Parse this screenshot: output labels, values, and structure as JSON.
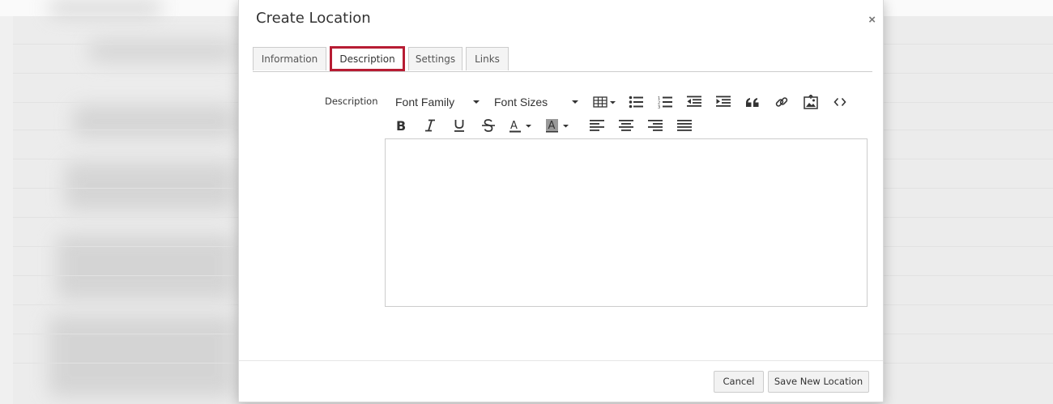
{
  "modal": {
    "title": "Create Location",
    "close_glyph": "×"
  },
  "tabs": [
    {
      "label": "Information",
      "active": false
    },
    {
      "label": "Description",
      "active": true
    },
    {
      "label": "Settings",
      "active": false
    },
    {
      "label": "Links",
      "active": false
    }
  ],
  "form": {
    "description_label": "Description",
    "editor_value": ""
  },
  "toolbar": {
    "font_family": "Font Family",
    "font_sizes": "Font Sizes",
    "row1_icons": [
      "table-icon",
      "bulleted-list-icon",
      "numbered-list-icon",
      "outdent-icon",
      "indent-icon",
      "blockquote-icon",
      "link-icon",
      "insert-image-icon",
      "source-code-icon"
    ],
    "row2_icons": [
      "bold-icon",
      "italic-icon",
      "underline-icon",
      "strikethrough-icon",
      "text-color-icon",
      "background-color-icon",
      "align-left-icon",
      "align-center-icon",
      "align-right-icon",
      "justify-icon"
    ]
  },
  "footer": {
    "cancel_label": "Cancel",
    "save_label": "Save New Location"
  },
  "colors": {
    "active_tab_border": "#b71c33"
  }
}
